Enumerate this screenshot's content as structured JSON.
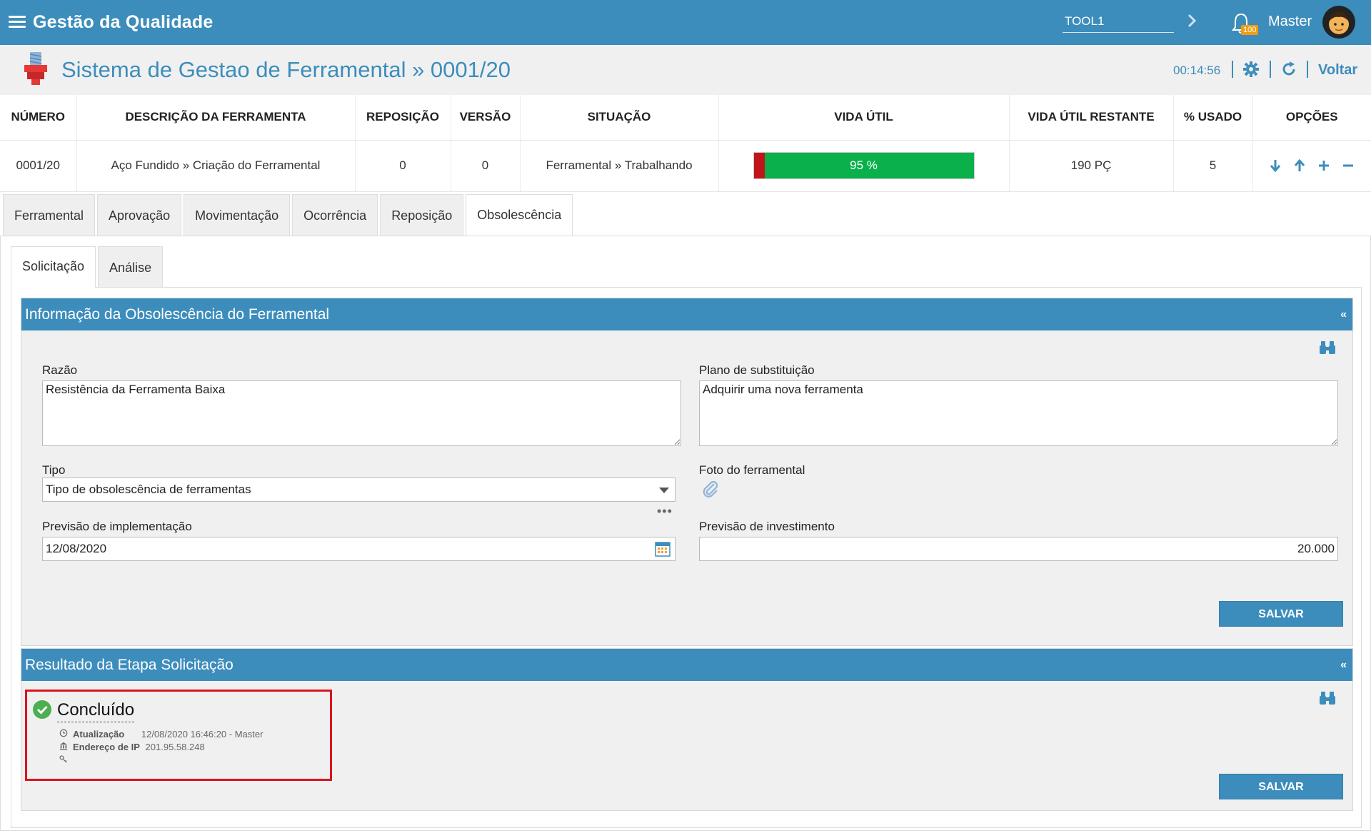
{
  "app": {
    "title": "Gestão da Qualidade",
    "tool_search_value": "TOOL1",
    "notification_count": "100",
    "user_name": "Master"
  },
  "page": {
    "title": "Sistema de Gestao de Ferramental » 0001/20",
    "clock": "00:14:56",
    "back_label": "Voltar"
  },
  "summary": {
    "headers": [
      "NÚMERO",
      "DESCRIÇÃO DA FERRAMENTA",
      "REPOSIÇÃO",
      "VERSÃO",
      "SITUAÇÃO",
      "VIDA ÚTIL",
      "VIDA ÚTIL RESTANTE",
      "% USADO",
      "OPÇÕES"
    ],
    "row": {
      "numero": "0001/20",
      "descricao": "Aço Fundido » Criação do Ferramental",
      "reposicao": "0",
      "versao": "0",
      "situacao": "Ferramental » Trabalhando",
      "vida_util_label": "95 %",
      "vida_util_percent": 95,
      "vida_util_restante": "190 PÇ",
      "usado": "5"
    },
    "colors": {
      "bar_green": "#0ab04a",
      "bar_red": "#c0161b"
    }
  },
  "tabs": [
    "Ferramental",
    "Aprovação",
    "Movimentação",
    "Ocorrência",
    "Reposição",
    "Obsolescência"
  ],
  "active_tab": "Obsolescência",
  "subtabs": [
    "Solicitação",
    "Análise"
  ],
  "active_subtab": "Solicitação",
  "info_box": {
    "title": "Informação da Obsolescência do Ferramental",
    "collapse_label": "«",
    "razao_label": "Razão",
    "razao_value": "Resistência da Ferramenta Baixa",
    "plano_label": "Plano de substituição",
    "plano_value": "Adquirir uma nova ferramenta",
    "tipo_label": "Tipo",
    "tipo_value": "Tipo de obsolescência de ferramentas",
    "tipo_more": "•••",
    "foto_label": "Foto do ferramental",
    "previsao_impl_label": "Previsão de implementação",
    "previsao_impl_value": "12/08/2020",
    "previsao_inv_label": "Previsão de investimento",
    "previsao_inv_value": "20.000",
    "save_label": "SALVAR"
  },
  "result_box": {
    "title": "Resultado da Etapa Solicitação",
    "collapse_label": "«",
    "status": "Concluído",
    "update_label": "Atualização",
    "update_value": "12/08/2020 16:46:20 - Master",
    "ip_label": "Endereço de IP",
    "ip_value": "201.95.58.248",
    "save_label": "SALVAR",
    "highlight_color": "#d9141e",
    "status_color": "#4caf50"
  },
  "icons": [
    "menu-icon",
    "chevron-right-icon",
    "bell-icon",
    "avatar",
    "tool-logo-icon",
    "gear-icon",
    "refresh-icon",
    "arrow-down-icon",
    "arrow-up-icon",
    "plus-icon",
    "minus-icon",
    "binoculars-icon",
    "paperclip-icon",
    "calendar-icon",
    "check-circle-icon",
    "clock-icon",
    "bank-icon",
    "key-icon"
  ]
}
